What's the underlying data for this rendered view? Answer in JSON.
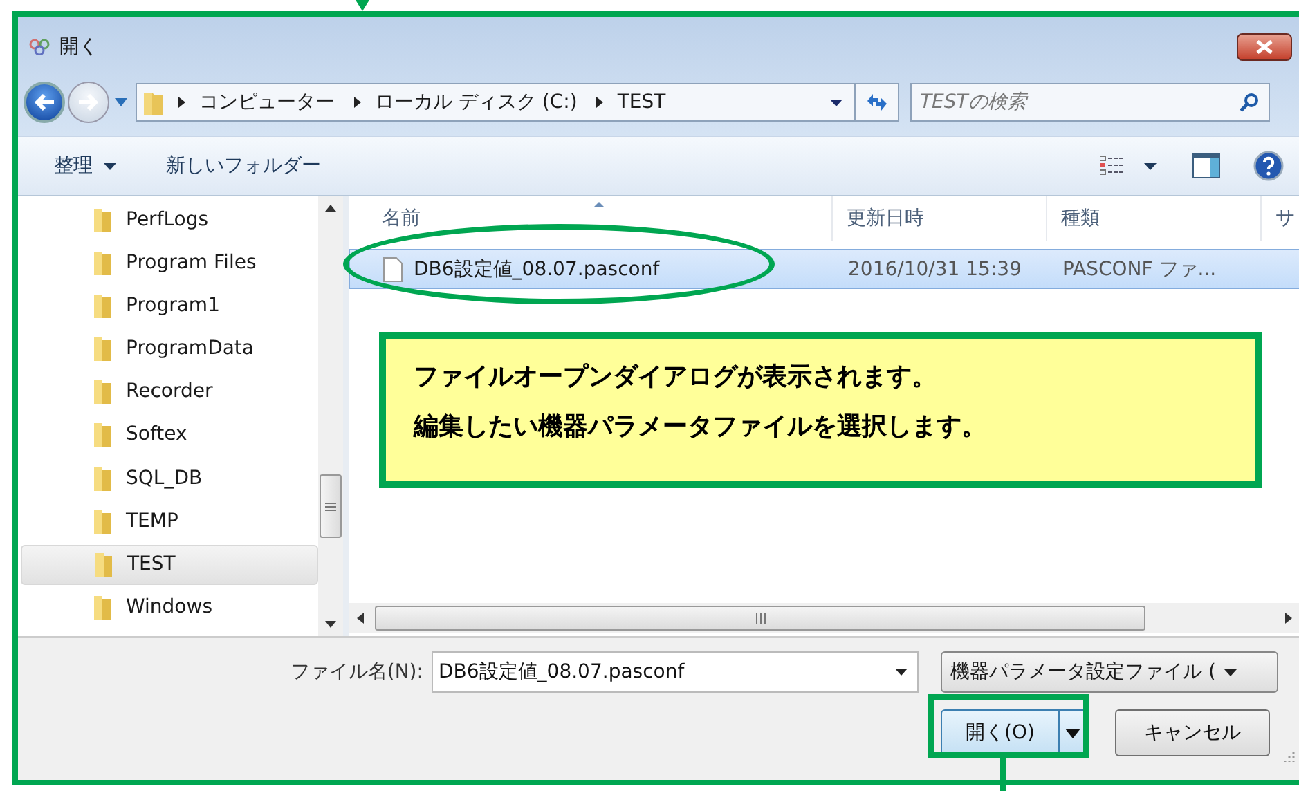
{
  "window": {
    "title": "開く"
  },
  "address": {
    "crumbs": [
      "コンピューター",
      "ローカル ディスク (C:)",
      "TEST"
    ]
  },
  "search": {
    "placeholder": "TESTの検索"
  },
  "toolbar": {
    "organize": "整理",
    "new_folder": "新しいフォルダー"
  },
  "sidebar": {
    "items": [
      {
        "label": "PerfLogs",
        "selected": false
      },
      {
        "label": "Program Files",
        "selected": false
      },
      {
        "label": "Program1",
        "selected": false
      },
      {
        "label": "ProgramData",
        "selected": false
      },
      {
        "label": "Recorder",
        "selected": false
      },
      {
        "label": "Softex",
        "selected": false
      },
      {
        "label": "SQL_DB",
        "selected": false
      },
      {
        "label": "TEMP",
        "selected": false
      },
      {
        "label": "TEST",
        "selected": true
      },
      {
        "label": "Windows",
        "selected": false
      }
    ]
  },
  "table": {
    "columns": [
      "名前",
      "更新日時",
      "種類",
      "サ"
    ],
    "rows": [
      {
        "cells": [
          "DB6設定値_08.07.pasconf",
          "2016/10/31 15:39",
          "PASCONF ファ..."
        ],
        "selected": true
      }
    ]
  },
  "callout": {
    "lines": [
      "ファイルオープンダイアログが表示されます。",
      "編集したい機器パラメータファイルを選択します。"
    ]
  },
  "filename": {
    "label": "ファイル名(N):",
    "value": "DB6設定値_08.07.pasconf"
  },
  "filter": {
    "value": "機器パラメータ設定ファイル ("
  },
  "buttons": [
    {
      "label": "開く(O)",
      "kind": "split"
    },
    {
      "label": "キャンセル",
      "kind": "plain"
    }
  ]
}
